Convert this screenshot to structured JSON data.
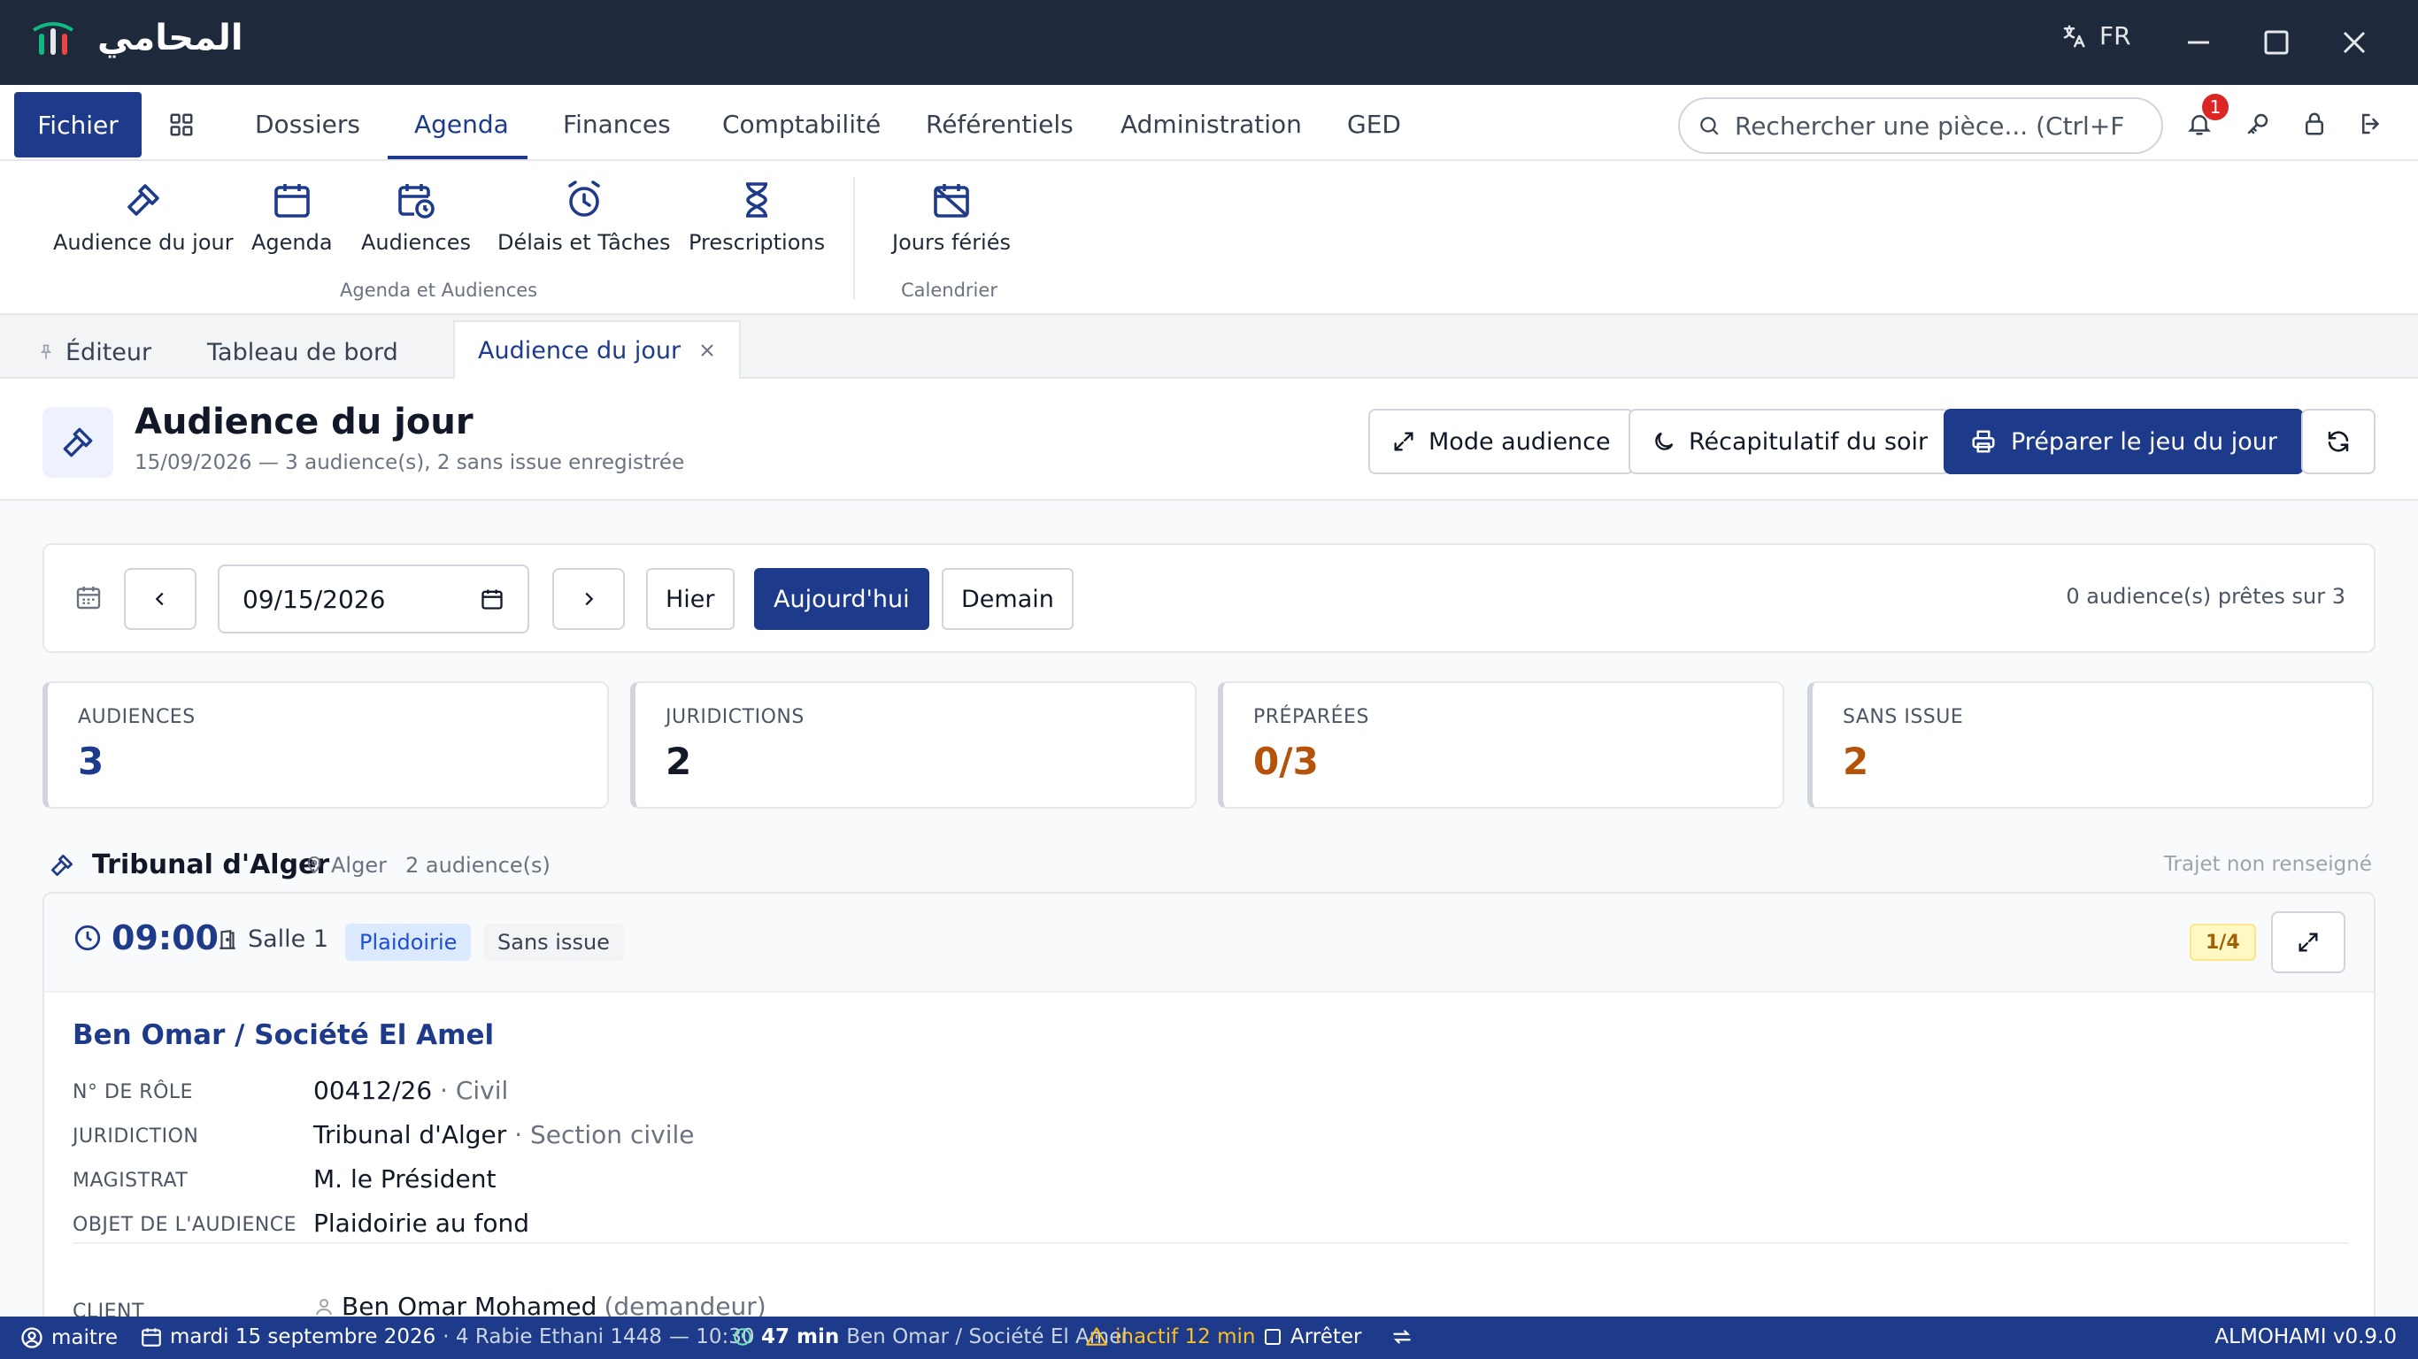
{
  "app": {
    "title": "المحامي",
    "language": "FR",
    "version": "ALMOHAMI v0.9.0"
  },
  "menu": {
    "file": "Fichier",
    "items": [
      "Dossiers",
      "Agenda",
      "Finances",
      "Comptabilité",
      "Référentiels",
      "Administration",
      "GED"
    ],
    "active": "Agenda"
  },
  "search": {
    "placeholder": "Rechercher une pièce... (Ctrl+F)"
  },
  "notifications": {
    "count": "1"
  },
  "ribbon": {
    "buttons": [
      "Audience du jour",
      "Agenda",
      "Audiences",
      "Délais et Tâches",
      "Prescriptions",
      "Jours fériés"
    ],
    "groups": [
      "Agenda et Audiences",
      "Calendrier"
    ]
  },
  "tabs": {
    "pinned": "Éditeur",
    "dashboard": "Tableau de bord",
    "active": "Audience du jour"
  },
  "page": {
    "title": "Audience du jour",
    "subtitle": "15/09/2026 — 3 audience(s), 2 sans issue enregistrée",
    "btn_mode": "Mode audience",
    "btn_recap": "Récapitulatif du soir",
    "btn_prepare": "Préparer le jeu du jour"
  },
  "datebar": {
    "date_value": "09/15/2026",
    "yesterday": "Hier",
    "today": "Aujourd'hui",
    "tomorrow": "Demain",
    "ready": "0 audience(s) prêtes sur 3"
  },
  "stats": [
    {
      "label": "AUDIENCES",
      "value": "3",
      "color": "#1e3a8a"
    },
    {
      "label": "JURIDICTIONS",
      "value": "2",
      "color": "#111827"
    },
    {
      "label": "PRÉPARÉES",
      "value": "0/3",
      "color": "#b45309"
    },
    {
      "label": "SANS ISSUE",
      "value": "2",
      "color": "#b45309"
    }
  ],
  "court": {
    "name": "Tribunal d'Alger",
    "location": "Alger",
    "count": "2 audience(s)",
    "trajet": "Trajet non renseigné"
  },
  "hearing": {
    "time": "09:00",
    "room": "Salle 1",
    "type": "Plaidoirie",
    "status": "Sans issue",
    "progress": "1/4",
    "title": "Ben Omar / Société El Amel",
    "fields": {
      "role_label": "N° DE RÔLE",
      "role_value": "00412/26",
      "role_extra": " · Civil",
      "juridiction_label": "JURIDICTION",
      "juridiction_value": "Tribunal d'Alger",
      "juridiction_extra": " · Section civile",
      "magistrat_label": "MAGISTRAT",
      "magistrat_value": "M. le Président",
      "objet_label": "OBJET DE L'AUDIENCE",
      "objet_value": "Plaidoirie au fond",
      "client_label": "CLIENT",
      "client_value": "Ben Omar Mohamed",
      "client_extra": "(demandeur)"
    }
  },
  "statusbar": {
    "user": "maitre",
    "date": "mardi 15 septembre 2026",
    "hijri": "· 4 Rabie Ethani 1448",
    "time": "— 10:30",
    "timer": "47 min",
    "timer_case": "Ben Omar / Société El Amel",
    "inactive": "inactif 12 min",
    "stop": "Arrêter"
  },
  "icons": [
    "translate-icon",
    "bell-icon",
    "key-icon",
    "lock-icon",
    "logout-icon",
    "gavel-icon",
    "calendar-icon",
    "calendar-clock-icon",
    "alarm-icon",
    "hourglass-icon",
    "calendar-off-icon",
    "pin-icon",
    "close-icon",
    "expand-icon",
    "moon-icon",
    "printer-icon",
    "refresh-icon",
    "chevron-left-icon",
    "chevron-right-icon",
    "clock-icon",
    "door-icon",
    "map-pin-icon",
    "user-icon",
    "warning-icon"
  ]
}
